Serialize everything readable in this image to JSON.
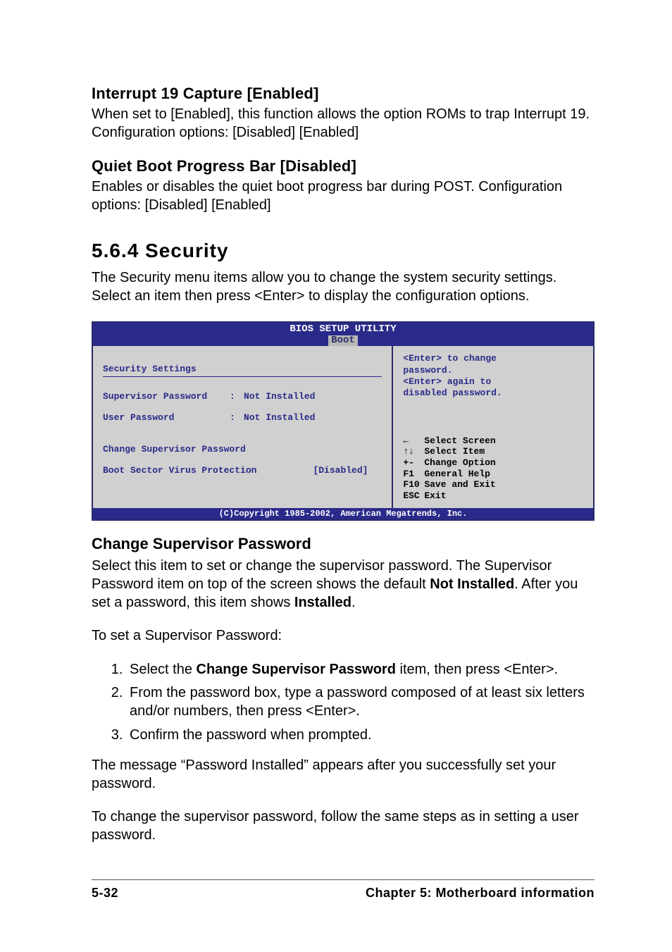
{
  "features": {
    "interrupt19": {
      "heading": "Interrupt 19 Capture [Enabled]",
      "body": "When set to [Enabled], this function allows the option ROMs to trap Interrupt 19. Configuration options: [Disabled] [Enabled]"
    },
    "quietBoot": {
      "heading": "Quiet Boot Progress Bar [Disabled]",
      "body": "Enables or disables the quiet boot progress bar during POST. Configuration options: [Disabled] [Enabled]"
    }
  },
  "section": {
    "number_heading": "5.6.4   Security",
    "intro": "The Security menu items allow you to change the system security settings. Select an item then press <Enter> to display the configuration options."
  },
  "bios": {
    "title": "BIOS SETUP UTILITY",
    "tab": "Boot",
    "security_heading": "Security Settings",
    "rows": {
      "supervisor": {
        "label": "Supervisor Password",
        "value": "Not Installed"
      },
      "user": {
        "label": "User Password",
        "value": "Not Installed"
      }
    },
    "change_supervisor": "Change Supervisor Password",
    "bsvp": {
      "label": "Boot Sector Virus Protection",
      "value": "[Disabled]"
    },
    "help": {
      "l1": "<Enter> to change",
      "l2": "password.",
      "l3": "<Enter> again to",
      "l4": "disabled password."
    },
    "keys": {
      "k1": "←",
      "v1": "Select Screen",
      "k2": "↑↓",
      "v2": "Select Item",
      "k3": "+-",
      "v3": "Change Option",
      "k4": "F1",
      "v4": "General Help",
      "k5": "F10",
      "v5": "Save and Exit",
      "k6": "ESC",
      "v6": "Exit"
    },
    "copyright": "(C)Copyright 1985-2002, American Megatrends, Inc."
  },
  "change_supervisor": {
    "heading": "Change Supervisor Password",
    "p1a": "Select this item to set or change the supervisor password. The Supervisor Password item on top of the screen shows the default ",
    "p1b": "Not Installed",
    "p1c": ". After you set a password, this item shows ",
    "p1d": "Installed",
    "p1e": ".",
    "lead": "To set a Supervisor Password:",
    "s1a": "Select the ",
    "s1b": "Change Supervisor Password",
    "s1c": " item, then press <Enter>.",
    "s2": "From the password box, type a password composed of at least six letters and/or numbers, then press <Enter>.",
    "s3": "Confirm the password when prompted.",
    "after": "The message “Password Installed” appears after you successfully set your password.",
    "change_note": "To change the supervisor password, follow the same steps as in setting a user password."
  },
  "footer": {
    "left": "5-32",
    "right": "Chapter 5:  Motherboard information"
  }
}
